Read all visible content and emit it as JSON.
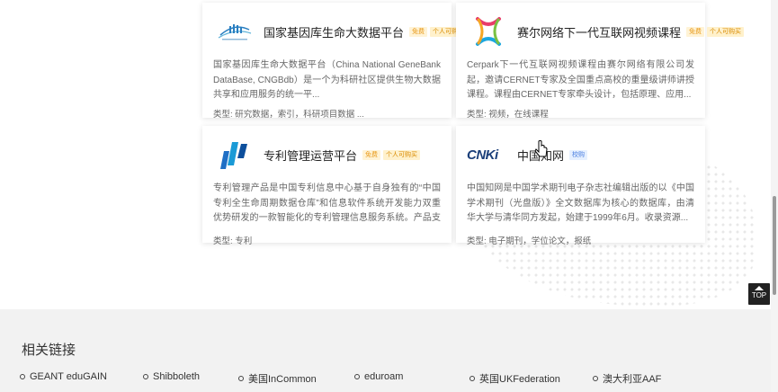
{
  "cards": [
    {
      "title": "国家基因库生命大数据平台",
      "badges": [
        "免费",
        "个人可购买"
      ],
      "desc": "国家基因库生命大数据平台（China National GeneBank DataBase, CNGBdb）是一个为科研社区提供生物大数据共享和应用服务的统一平...",
      "type_label": "类型:",
      "type_value": "研究数据，索引，科研项目数据 ..."
    },
    {
      "title": "赛尔网络下一代互联网视频课程",
      "badges": [
        "免费",
        "个人可购买"
      ],
      "desc": "Cerpark下一代互联网视频课程由赛尔网络有限公司发起，邀请CERNET专家及全国重点高校的重量级讲师讲授课程。课程由CERNET专家牵头设计，包括原理、应用...",
      "type_label": "类型:",
      "type_value": "视频，在线课程"
    },
    {
      "title": "专利管理运营平台",
      "badges": [
        "免费",
        "个人可购买"
      ],
      "desc": "专利管理产品是中国专利信息中心基于自身独有的“中国专利全生命周期数据仓库”和信息软件系统开发能力双重优势研发的一款智能化的专利管理信息服务系统。产品支持多角色...",
      "type_label": "类型:",
      "type_value": "专利"
    },
    {
      "title": "中国知网",
      "badges": [
        "校购"
      ],
      "desc": "中国知网是中国学术期刊电子杂志社编辑出版的以《中国学术期刊（光盘版）》全文数据库为核心的数据库，由清华大学与清华同方发起，始建于1999年6月。收录资源...",
      "type_label": "类型:",
      "type_value": "电子期刊，学位论文，报纸",
      "logo_text": "CNKi"
    }
  ],
  "top_button": "TOP",
  "footer": {
    "title": "相关链接",
    "links": [
      "GEANT eduGAIN",
      "Shibboleth",
      "美国InCommon",
      "eduroam",
      "英国UKFederation",
      "澳大利亚AAF"
    ]
  },
  "colors": {
    "badge_free": "#e89a1a",
    "badge_school": "#4a7ee0",
    "footer_bg": "#f2f2f2"
  }
}
